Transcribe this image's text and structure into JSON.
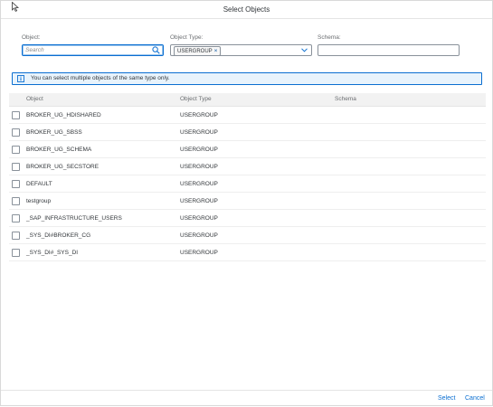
{
  "dialog": {
    "title": "Select Objects"
  },
  "filters": {
    "object_label": "Object:",
    "object_placeholder": "Search",
    "object_value": "",
    "type_label": "Object Type:",
    "type_token": "USERGROUP",
    "schema_label": "Schema:",
    "schema_value": ""
  },
  "info": {
    "message": "You can select multiple objects of the same type only."
  },
  "table": {
    "columns": [
      "Object",
      "Object Type",
      "Schema"
    ],
    "rows": [
      {
        "object": "BROKER_UG_HDISHARED",
        "type": "USERGROUP",
        "schema": ""
      },
      {
        "object": "BROKER_UG_SBSS",
        "type": "USERGROUP",
        "schema": ""
      },
      {
        "object": "BROKER_UG_SCHEMA",
        "type": "USERGROUP",
        "schema": ""
      },
      {
        "object": "BROKER_UG_SECSTORE",
        "type": "USERGROUP",
        "schema": ""
      },
      {
        "object": "DEFAULT",
        "type": "USERGROUP",
        "schema": ""
      },
      {
        "object": "testgroup",
        "type": "USERGROUP",
        "schema": ""
      },
      {
        "object": "_SAP_INFRASTRUCTURE_USERS",
        "type": "USERGROUP",
        "schema": ""
      },
      {
        "object": "_SYS_DI#BROKER_CG",
        "type": "USERGROUP",
        "schema": ""
      },
      {
        "object": "_SYS_DI#_SYS_DI",
        "type": "USERGROUP",
        "schema": ""
      }
    ]
  },
  "footer": {
    "select_label": "Select",
    "cancel_label": "Cancel"
  },
  "colors": {
    "accent": "#0a6ed1",
    "info_bg": "#e8f3fc",
    "header_bg": "#f2f2f2"
  }
}
